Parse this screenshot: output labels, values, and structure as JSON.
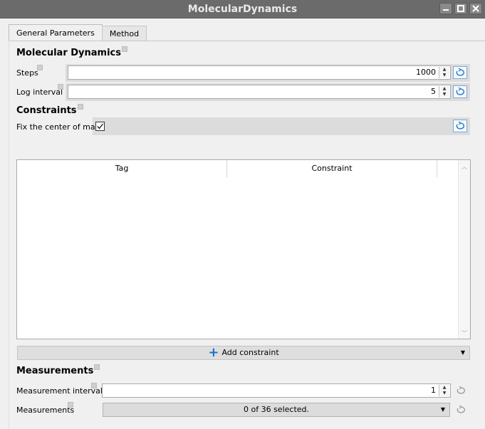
{
  "window": {
    "title": "MolecularDynamics"
  },
  "tabs": [
    {
      "label": "General Parameters",
      "active": true
    },
    {
      "label": "Method",
      "active": false
    }
  ],
  "molecular_dynamics": {
    "title": "Molecular Dynamics",
    "steps": {
      "label": "Steps",
      "value": "1000"
    },
    "log_interval": {
      "label": "Log interval",
      "value": "5"
    }
  },
  "constraints": {
    "title": "Constraints",
    "fix_com": {
      "label": "Fix the center of mass",
      "checked": true
    },
    "table": {
      "columns": [
        "Tag",
        "Constraint"
      ],
      "rows": []
    },
    "add_label": "Add constraint"
  },
  "measurements": {
    "title": "Measurements",
    "interval": {
      "label": "Measurement interval",
      "value": "1"
    },
    "select": {
      "label": "Measurements",
      "value": "0 of 36 selected."
    }
  },
  "icons": {
    "reset": "reset-icon",
    "minimize": "minimize-icon",
    "maximize": "maximize-icon",
    "close": "close-icon",
    "plus": "plus-icon"
  },
  "colors": {
    "titlebar": "#6b6b6b",
    "accent": "#1a72c9",
    "panel_bg": "#f0f0f0"
  }
}
